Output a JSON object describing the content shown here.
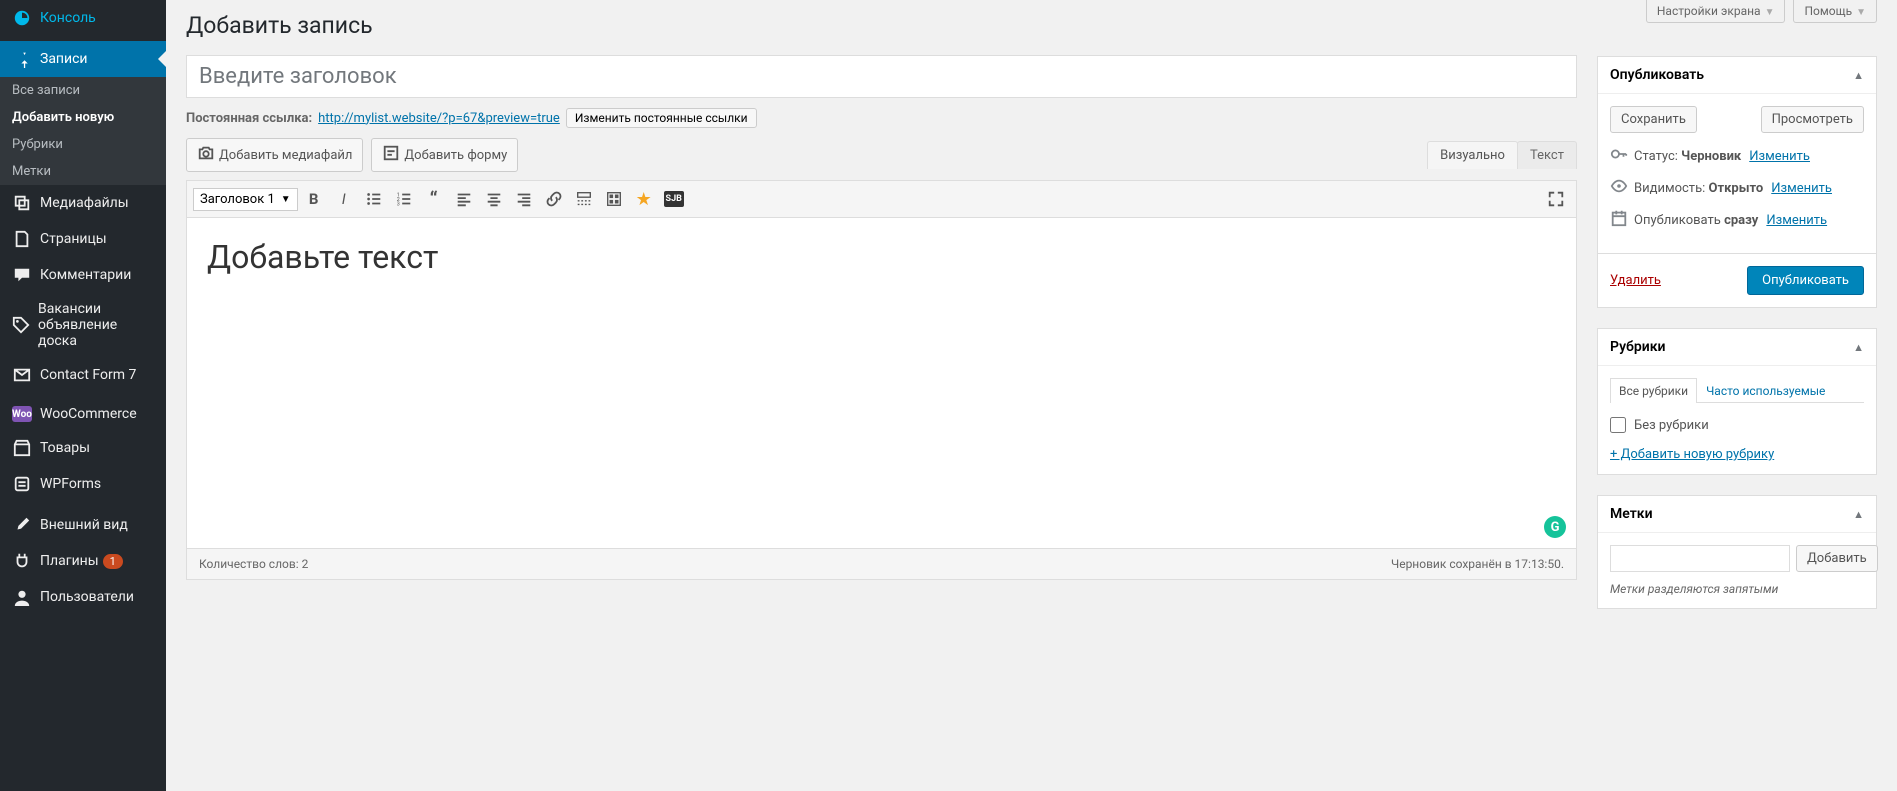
{
  "sidebar": {
    "console": "Консоль",
    "posts": "Записи",
    "sub": {
      "all": "Все записи",
      "add": "Добавить новую",
      "categories": "Рубрики",
      "tags": "Метки"
    },
    "media": "Медиафайлы",
    "pages": "Страницы",
    "comments": "Комментарии",
    "jobs": "Вакансии объявление доска",
    "cf7": "Contact Form 7",
    "woo": "WooCommerce",
    "products": "Товары",
    "wpforms": "WPForms",
    "appearance": "Внешний вид",
    "plugins": "Плагины",
    "plugins_badge": "1",
    "users": "Пользователи"
  },
  "topTabs": {
    "screenOptions": "Настройки экрана",
    "help": "Помощь"
  },
  "page": {
    "title": "Добавить запись",
    "titlePlaceholder": "Введите заголовок",
    "permalinkLabel": "Постоянная ссылка:",
    "permalinkUrl": "http://mylist.website/?p=67&preview=true",
    "permalinkBtn": "Изменить постоянные ссылки",
    "addMedia": "Добавить медиафайл",
    "addForm": "Добавить форму",
    "visualTab": "Визуально",
    "textTab": "Текст",
    "formatSelect": "Заголовок 1",
    "contentBody": "Добавьте текст",
    "wordCountLabel": "Количество слов:",
    "wordCount": "2",
    "draftSaved": "Черновик сохранён в 17:13:50."
  },
  "publish": {
    "title": "Опубликовать",
    "save": "Сохранить",
    "preview": "Просмотреть",
    "statusLabel": "Статус:",
    "statusValue": "Черновик",
    "visibilityLabel": "Видимость:",
    "visibilityValue": "Открыто",
    "scheduleLabel": "Опубликовать",
    "scheduleValue": "сразу",
    "edit": "Изменить",
    "delete": "Удалить",
    "publishBtn": "Опубликовать"
  },
  "categories": {
    "title": "Рубрики",
    "tabAll": "Все рубрики",
    "tabMost": "Часто используемые",
    "uncategorized": "Без рубрики",
    "addNew": "+ Добавить новую рубрику"
  },
  "tags": {
    "title": "Метки",
    "addBtn": "Добавить",
    "hint": "Метки разделяются запятыми"
  }
}
